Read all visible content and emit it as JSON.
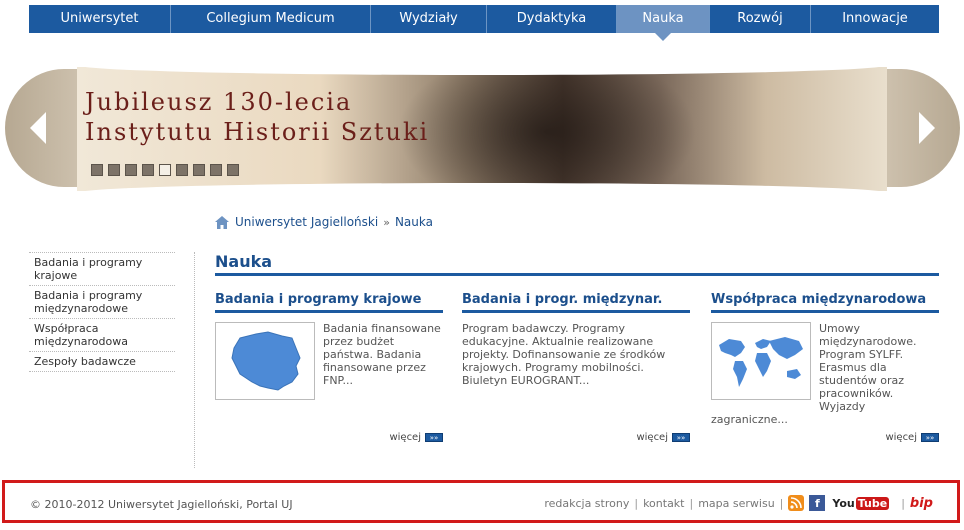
{
  "nav": {
    "items": [
      {
        "label": "Uniwersytet"
      },
      {
        "label": "Collegium Medicum"
      },
      {
        "label": "Wydziały"
      },
      {
        "label": "Dydaktyka"
      },
      {
        "label": "Nauka",
        "active": true
      },
      {
        "label": "Rozwój"
      },
      {
        "label": "Innowacje"
      }
    ]
  },
  "banner": {
    "title_line1": "Jubileusz 130-lecia",
    "title_line2": "Instytutu Historii Sztuki",
    "prev_icon": "arrow-left-icon",
    "next_icon": "arrow-right-icon",
    "slide_count": 9,
    "active_slide": 5
  },
  "breadcrumb": {
    "home_icon": "home-icon",
    "items": [
      "Uniwersytet Jagielloński",
      "Nauka"
    ],
    "separator": "»"
  },
  "sidebar": {
    "items": [
      "Badania i programy krajowe",
      "Badania i programy międzynarodowe",
      "Współpraca międzynarodowa",
      "Zespoły badawcze"
    ]
  },
  "main": {
    "title": "Nauka",
    "columns": [
      {
        "heading": "Badania i programy krajowe",
        "image": "poland-map-icon",
        "text": "Badania finansowane przez budżet państwa. Badania finansowane przez FNP...",
        "more": "więcej"
      },
      {
        "heading": "Badania i progr. międzynar.",
        "text": "Program badawczy. Programy edukacyjne. Aktualnie realizowane projekty. Dofinansowanie ze środków krajowych. Programy mobilności. Biuletyn EUROGRANT...",
        "more": "więcej"
      },
      {
        "heading": "Współpraca międzynarodowa",
        "image": "world-map-icon",
        "text": "Umowy międzynarodowe. Program SYLFF. Erasmus dla studentów oraz pracowników. Wyjazdy zagraniczne...",
        "more": "więcej"
      }
    ]
  },
  "footer": {
    "copyright": "© 2010-2012 Uniwersytet Jagielloński, Portal UJ",
    "links": [
      "redakcja strony",
      "kontakt",
      "mapa serwisu"
    ],
    "separator": "|",
    "icons": [
      "rss-icon",
      "facebook-icon",
      "youtube-icon"
    ],
    "youtube_you": "You",
    "youtube_tube": "Tube",
    "bip": "bip",
    "border_color": "#d11a1a"
  }
}
